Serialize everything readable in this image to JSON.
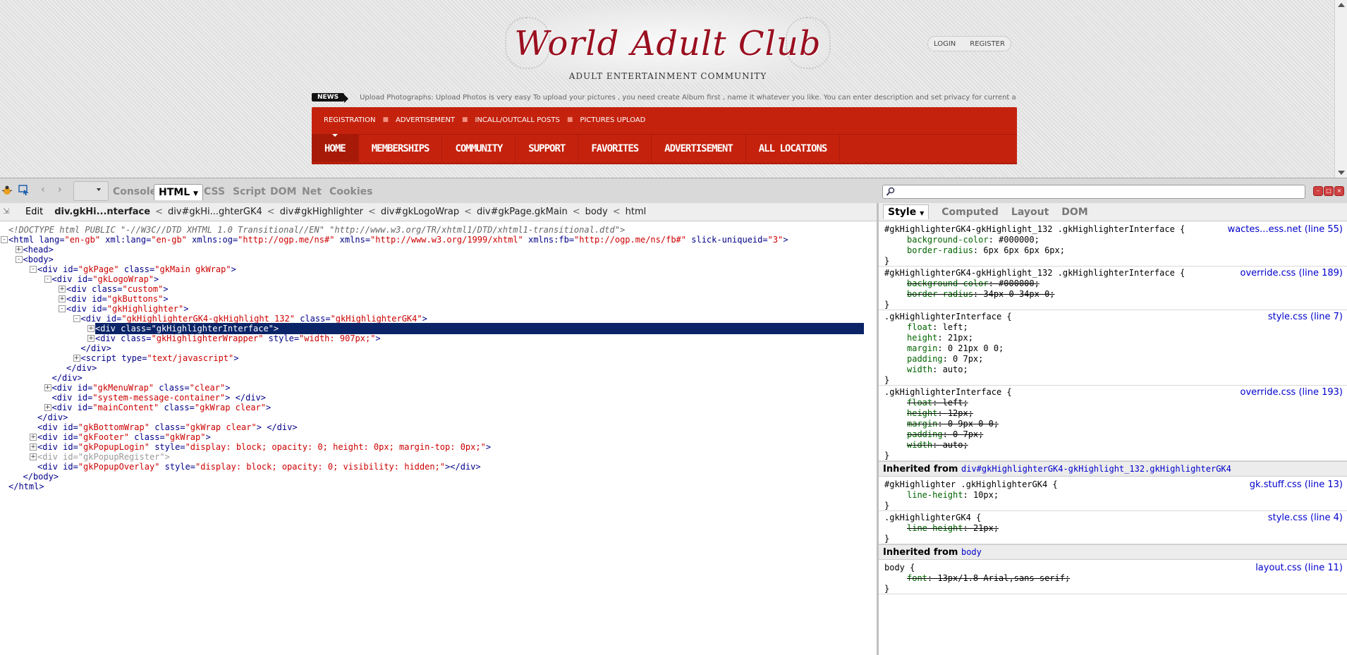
{
  "site": {
    "logo_title": "World Adult Club",
    "logo_subtitle": "ADULT ENTERTAINMENT COMMUNITY",
    "login": "LOGIN",
    "register": "REGISTER",
    "news_tag": "NEWS",
    "news_text": "Upload Photographs: Upload Photos is very easy To upload your pictures , you need create Album first , name it whatever you like. You can enter description and set privacy for current a",
    "subnav": [
      "REGISTRATION",
      "ADVERTISEMENT",
      "INCALL/OUTCALL POSTS",
      "PICTURES UPLOAD"
    ],
    "mainnav": [
      "HOME",
      "MEMBERSHIPS",
      "COMMUNITY",
      "SUPPORT",
      "FAVORITES",
      "ADVERTISEMENT",
      "ALL LOCATIONS"
    ]
  },
  "firebug": {
    "tabs": [
      "Console",
      "HTML",
      "CSS",
      "Script",
      "DOM",
      "Net",
      "Cookies"
    ],
    "active_tab": "HTML",
    "breadcrumb_edit": "Edit",
    "breadcrumbs": [
      "div.gkHi...nterface",
      "div#gkHi...ghterGK4",
      "div#gkHighlighter",
      "div#gkLogoWrap",
      "div#gkPage.gkMain",
      "body",
      "html"
    ],
    "side_tabs": [
      "Style",
      "Computed",
      "Layout",
      "DOM"
    ],
    "side_active": "Style",
    "tree": [
      {
        "t": "<!DOCTYPE html PUBLIC \"-//W3C//DTD XHTML 1.0 Transitional//EN\" \"http://www.w3.org/TR/xhtml1/DTD/xhtml1-transitional.dtd\">"
      },
      {
        "t": "<html lang=\"en-gb\" xml:lang=\"en-gb\" xmlns:og=\"http://ogp.me/ns#\" xmlns=\"http://www.w3.org/1999/xhtml\" xmlns:fb=\"http://ogp.me/ns/fb#\" slick-uniqueid=\"3\">"
      },
      {
        "t": "<head>"
      },
      {
        "t": "<body>"
      },
      {
        "t": "<div id=\"gkPage\" class=\"gkMain gkWrap\">"
      },
      {
        "t": "<div id=\"gkLogoWrap\">"
      },
      {
        "t": "<div class=\"custom\">"
      },
      {
        "t": "<div id=\"gkButtons\">"
      },
      {
        "t": "<div id=\"gkHighlighter\">"
      },
      {
        "t": "<div id=\"gkHighlighterGK4-gkHighlight_132\" class=\"gkHighlighterGK4\">"
      },
      {
        "t": "<div class=\"gkHighlighterInterface\">"
      },
      {
        "t": "<div class=\"gkHighlighterWrapper\" style=\"width: 907px;\">"
      },
      {
        "t": "</div>"
      },
      {
        "t": "<script type=\"text/javascript\">"
      },
      {
        "t": "</div>"
      },
      {
        "t": "</div>"
      },
      {
        "t": "<div id=\"gkMenuWrap\" class=\"clear\">"
      },
      {
        "t": "<div id=\"system-message-container\"> </div>"
      },
      {
        "t": "<div id=\"mainContent\" class=\"gkWrap clear\">"
      },
      {
        "t": "</div>"
      },
      {
        "t": "<div id=\"gkBottomWrap\" class=\"gkWrap clear\"> </div>"
      },
      {
        "t": "<div id=\"gkFooter\" class=\"gkWrap\">"
      },
      {
        "t": "<div id=\"gkPopupLogin\" style=\"display: block; opacity: 0; height: 0px; margin-top: 0px;\">"
      },
      {
        "t": "<div id=\"gkPopupRegister\">"
      },
      {
        "t": "<div id=\"gkPopupOverlay\" style=\"display: block; opacity: 0; visibility: hidden;\"></div>"
      },
      {
        "t": "</body>"
      },
      {
        "t": "</html>"
      }
    ],
    "rules": [
      {
        "selector": "#gkHighlighterGK4-gkHighlight_132 .gkHighlighterInterface {",
        "source": "wactes...ess.net (line 55)",
        "props": [
          [
            "background-color",
            "#000000;",
            false
          ],
          [
            "border-radius",
            "6px 6px 6px 6px;",
            false
          ]
        ]
      },
      {
        "selector": "#gkHighlighterGK4-gkHighlight_132 .gkHighlighterInterface {",
        "source": "override.css (line 189)",
        "props": [
          [
            "background-color",
            "#000000;",
            true
          ],
          [
            "border-radius",
            "34px 0 34px 0;",
            true
          ]
        ]
      },
      {
        "selector": ".gkHighlighterInterface {",
        "source": "style.css (line 7)",
        "props": [
          [
            "float",
            "left;",
            false
          ],
          [
            "height",
            "21px;",
            false
          ],
          [
            "margin",
            "0 21px 0 0;",
            false
          ],
          [
            "padding",
            "0 7px;",
            false
          ],
          [
            "width",
            "auto;",
            false
          ]
        ]
      },
      {
        "selector": ".gkHighlighterInterface {",
        "source": "override.css (line 193)",
        "props": [
          [
            "float",
            "left;",
            true
          ],
          [
            "height",
            "12px;",
            true
          ],
          [
            "margin",
            "0 9px 0 0;",
            true
          ],
          [
            "padding",
            "0 7px;",
            true
          ],
          [
            "width",
            "auto;",
            true
          ]
        ]
      }
    ],
    "inherited1_label": "Inherited from",
    "inherited1_target": "div#gkHighlighterGK4-gkHighlight_132.gkHighlighterGK4",
    "rules2": [
      {
        "selector": "#gkHighlighter .gkHighlighterGK4 {",
        "source": "gk.stuff.css (line 13)",
        "props": [
          [
            "line-height",
            "10px;",
            false
          ]
        ]
      },
      {
        "selector": ".gkHighlighterGK4 {",
        "source": "style.css (line 4)",
        "props": [
          [
            "line-height",
            "21px;",
            true
          ]
        ]
      }
    ],
    "inherited2_label": "Inherited from",
    "inherited2_target": "body",
    "rules3": [
      {
        "selector": "body {",
        "source": "layout.css (line 11)",
        "props": [
          [
            "font",
            "13px/1.8 Arial,sans-serif;",
            true
          ]
        ]
      }
    ]
  }
}
